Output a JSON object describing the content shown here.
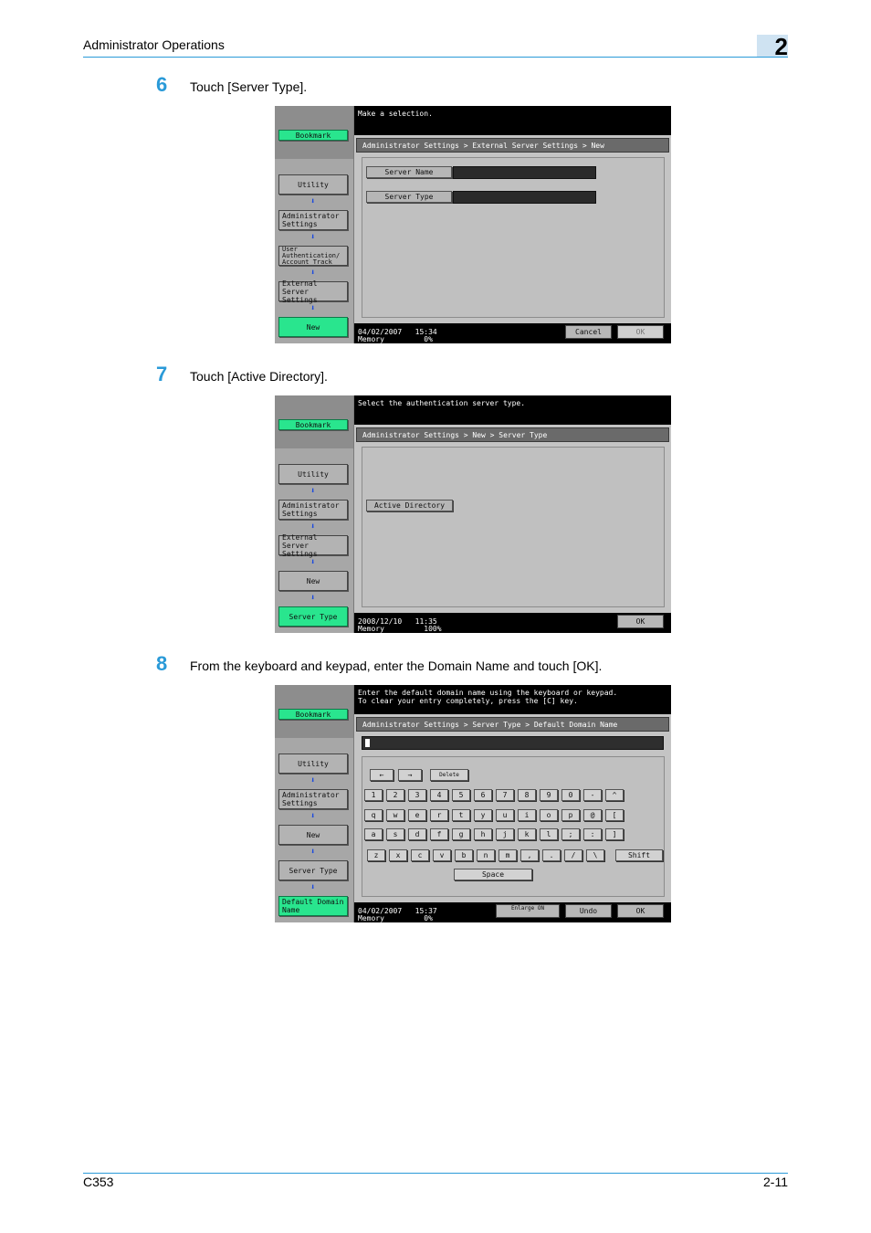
{
  "header": {
    "title": "Administrator Operations",
    "chapter": "2"
  },
  "footer": {
    "model": "C353",
    "page": "2-11"
  },
  "steps": [
    {
      "number": "6",
      "text": "Touch [Server Type].",
      "screen": {
        "message": "Make a selection.",
        "breadcrumb": "Administrator Settings > External Server Settings > New",
        "sidebar": [
          "Bookmark",
          "Utility",
          "Administrator Settings",
          "User Authentication/ Account Track",
          "External Server Settings",
          "New"
        ],
        "fields": [
          "Server Name",
          "Server Type"
        ],
        "date": "04/02/2007",
        "time": "15:34",
        "memory_label": "Memory",
        "memory_value": "0%",
        "cancel": "Cancel",
        "ok": "OK"
      }
    },
    {
      "number": "7",
      "text": "Touch [Active Directory].",
      "screen": {
        "message": "Select the authentication server type.",
        "breadcrumb": "Administrator Settings > New > Server Type",
        "sidebar": [
          "Bookmark",
          "Utility",
          "Administrator Settings",
          "External Server Settings",
          "New",
          "Server Type"
        ],
        "option": "Active Directory",
        "date": "2008/12/10",
        "time": "11:35",
        "memory_label": "Memory",
        "memory_value": "100%",
        "ok": "OK"
      }
    },
    {
      "number": "8",
      "text": "From the keyboard and keypad, enter the Domain Name and touch [OK].",
      "screen": {
        "message_line1": "Enter the default domain name using the keyboard or keypad.",
        "message_line2": "To clear your entry completely, press the [C] key.",
        "breadcrumb": "Administrator Settings > Server Type > Default Domain Name",
        "sidebar": [
          "Bookmark",
          "Utility",
          "Administrator Settings",
          "New",
          "Server Type",
          "Default Domain Name"
        ],
        "nav_keys": [
          "←",
          "→",
          "Delete"
        ],
        "row1": [
          "1",
          "2",
          "3",
          "4",
          "5",
          "6",
          "7",
          "8",
          "9",
          "0",
          "-",
          "^"
        ],
        "row2": [
          "q",
          "w",
          "e",
          "r",
          "t",
          "y",
          "u",
          "i",
          "o",
          "p",
          "@",
          "["
        ],
        "row3": [
          "a",
          "s",
          "d",
          "f",
          "g",
          "h",
          "j",
          "k",
          "l",
          ";",
          ":",
          "]"
        ],
        "row4": [
          "z",
          "x",
          "c",
          "v",
          "b",
          "n",
          "m",
          ",",
          ".",
          "/",
          "\\"
        ],
        "shift": "Shift",
        "space": "Space",
        "enlarge": "Enlarge ON",
        "undo": "Undo",
        "ok": "OK",
        "date": "04/02/2007",
        "time": "15:37",
        "memory_label": "Memory",
        "memory_value": "0%"
      }
    }
  ]
}
